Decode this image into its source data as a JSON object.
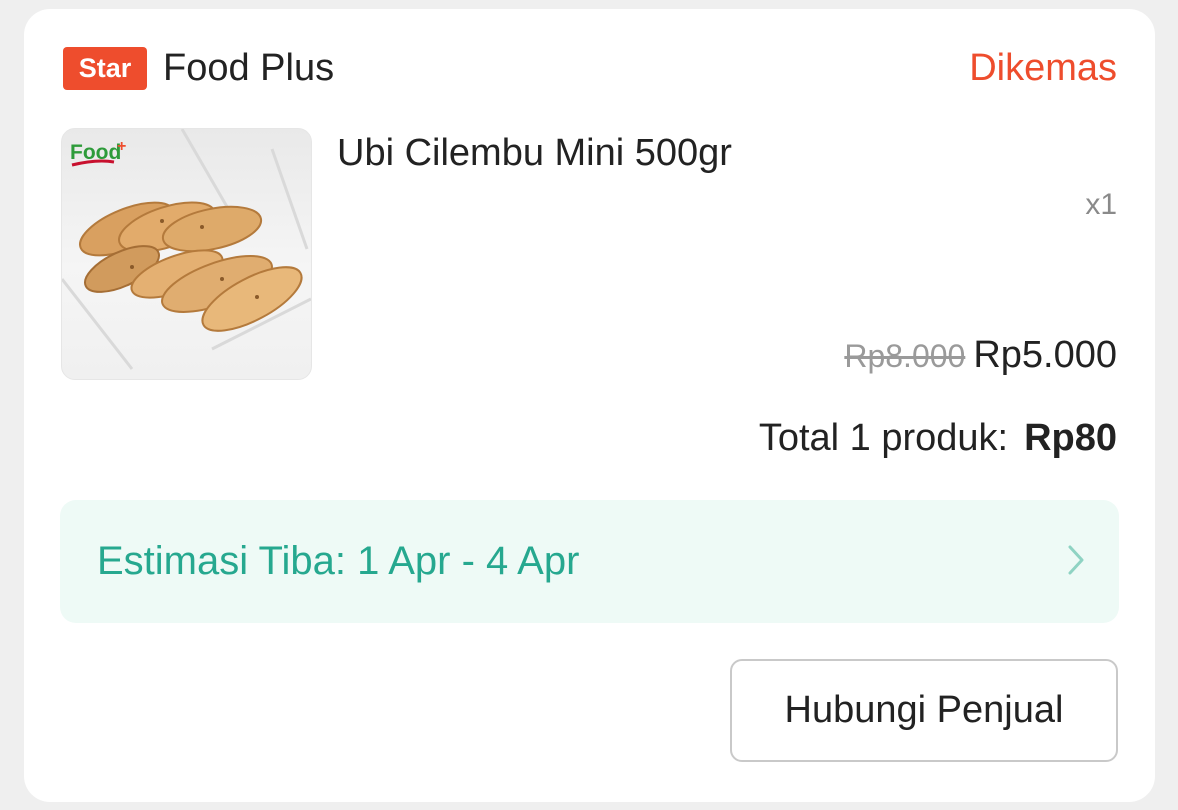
{
  "shop": {
    "badge": "Star",
    "name": "Food Plus",
    "status": "Dikemas"
  },
  "product": {
    "title": "Ubi Cilembu Mini 500gr",
    "quantity": "x1",
    "price_original": "Rp8.000",
    "price_final": "Rp5.000",
    "image_logo_text": "Food+"
  },
  "summary": {
    "total_label": "Total 1 produk:",
    "total_amount": "Rp80"
  },
  "delivery": {
    "estimate": "Estimasi Tiba: 1 Apr - 4 Apr",
    "chevron_icon": "chevron-right-icon"
  },
  "actions": {
    "contact_label": "Hubungi Penjual"
  },
  "colors": {
    "accent": "#ee4d2d",
    "teal": "#26a88f",
    "banner_bg": "#eefaf6"
  }
}
